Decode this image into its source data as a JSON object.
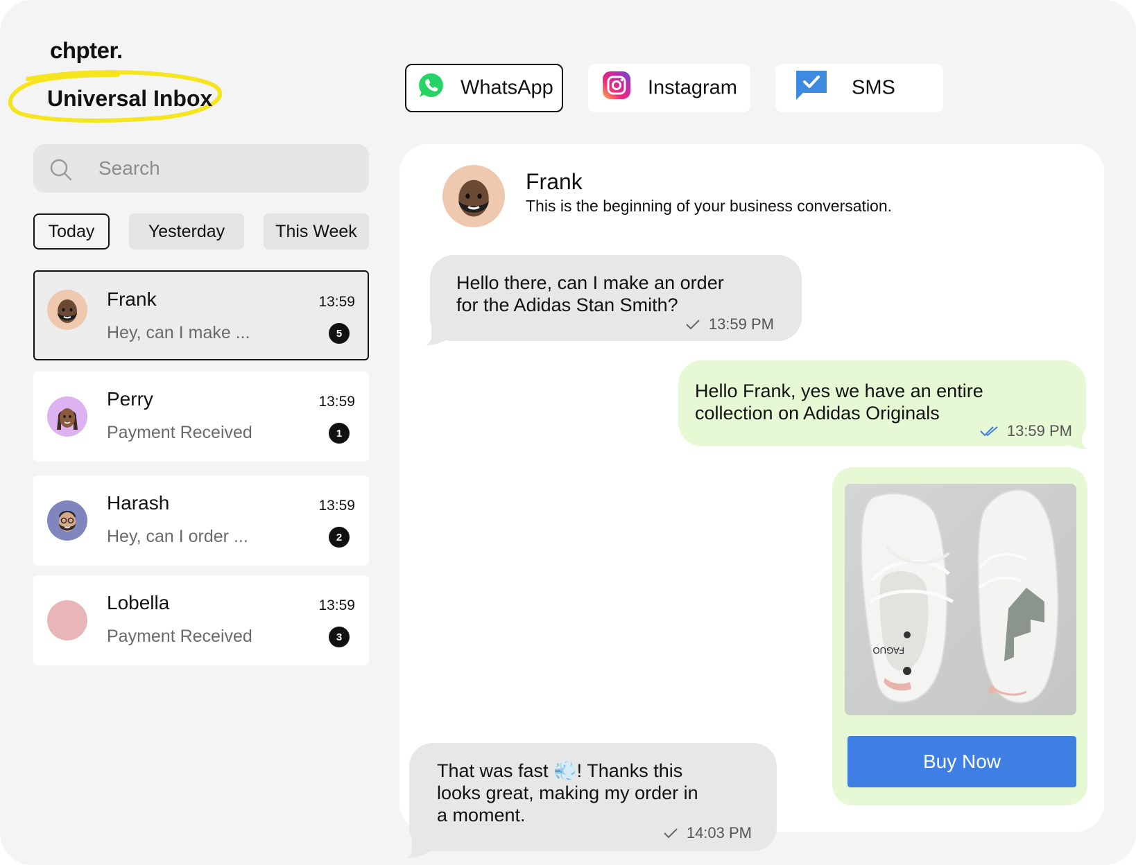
{
  "brand": "chpter.",
  "inbox_title": "Universal Inbox",
  "channels": [
    {
      "label": "WhatsApp",
      "icon": "whatsapp-icon",
      "color": "#25D366",
      "active": true
    },
    {
      "label": "Instagram",
      "icon": "instagram-icon",
      "active": false
    },
    {
      "label": "SMS",
      "icon": "sms-icon",
      "color": "#3d8ae0",
      "active": false
    }
  ],
  "search": {
    "placeholder": "Search",
    "value": ""
  },
  "filters": [
    {
      "label": "Today",
      "active": true
    },
    {
      "label": "Yesterday",
      "active": false
    },
    {
      "label": "This Week",
      "active": false
    }
  ],
  "conversations": [
    {
      "name": "Frank",
      "time": "13:59",
      "preview": "Hey, can I make ...",
      "unread": "5",
      "avatar_color": "#eec9b0",
      "selected": true
    },
    {
      "name": "Perry",
      "time": "13:59",
      "preview": "Payment Received",
      "unread": "1",
      "avatar_color": "#dcb2f0",
      "selected": false
    },
    {
      "name": "Harash",
      "time": "13:59",
      "preview": "Hey, can I order ...",
      "unread": "2",
      "avatar_color": "#7e86bd",
      "selected": false
    },
    {
      "name": "Lobella",
      "time": "13:59",
      "preview": "Payment Received",
      "unread": "3",
      "avatar_color": "#e8b6b6",
      "selected": false
    }
  ],
  "chat": {
    "contact_name": "Frank",
    "subtitle": "This is the beginning of your business conversation.",
    "messages": [
      {
        "direction": "in",
        "lines": [
          "Hello there, can I make an order",
          "for the Adidas Stan Smith?"
        ],
        "time": "13:59 PM",
        "status": "sent"
      },
      {
        "direction": "out",
        "lines": [
          "Hello Frank, yes we have an entire",
          "collection on Adidas Originals"
        ],
        "time": "13:59 PM",
        "status": "read"
      },
      {
        "direction": "in",
        "lines": [
          "That was fast 💨! Thanks this",
          "looks great, making my order in",
          "a moment."
        ],
        "time": "14:03 PM",
        "status": "sent"
      }
    ],
    "product": {
      "button_label": "Buy Now",
      "shoe_brand": "FAGUO"
    }
  },
  "colors": {
    "highlight": "#f5e51f",
    "accent_blue": "#3f7fe4",
    "outgoing_bubble": "#e6f9d4",
    "incoming_bubble": "#e7e7e7"
  }
}
